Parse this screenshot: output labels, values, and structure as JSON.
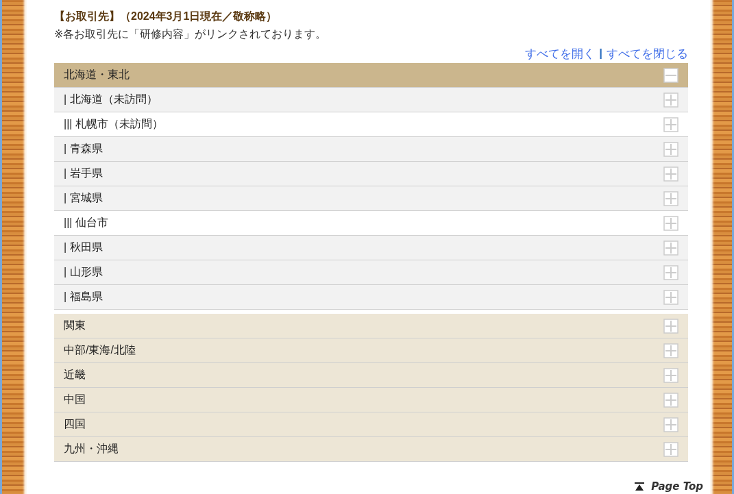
{
  "heading": "【お取引先】（2024年3月1日現在／敬称略）",
  "note": "※各お取引先に「研修内容」がリンクされております。",
  "controls": {
    "expand_all": "すべてを開く",
    "separator": "|",
    "collapse_all": "すべてを閉じる"
  },
  "regions": [
    {
      "label": "北海道・東北",
      "expanded": true,
      "children": [
        {
          "label": "| 北海道（未訪問）",
          "children": [
            {
              "label": "||| 札幌市（未訪問）"
            }
          ]
        },
        {
          "label": "| 青森県"
        },
        {
          "label": "| 岩手県"
        },
        {
          "label": "| 宮城県",
          "children": [
            {
              "label": "||| 仙台市"
            }
          ]
        },
        {
          "label": "| 秋田県"
        },
        {
          "label": "| 山形県"
        },
        {
          "label": "| 福島県"
        }
      ]
    },
    {
      "label": "関東",
      "expanded": false
    },
    {
      "label": "中部/東海/北陸",
      "expanded": false
    },
    {
      "label": "近畿",
      "expanded": false
    },
    {
      "label": "中国",
      "expanded": false
    },
    {
      "label": "四国",
      "expanded": false
    },
    {
      "label": "九州・沖縄",
      "expanded": false
    }
  ],
  "page_top": "Page Top"
}
